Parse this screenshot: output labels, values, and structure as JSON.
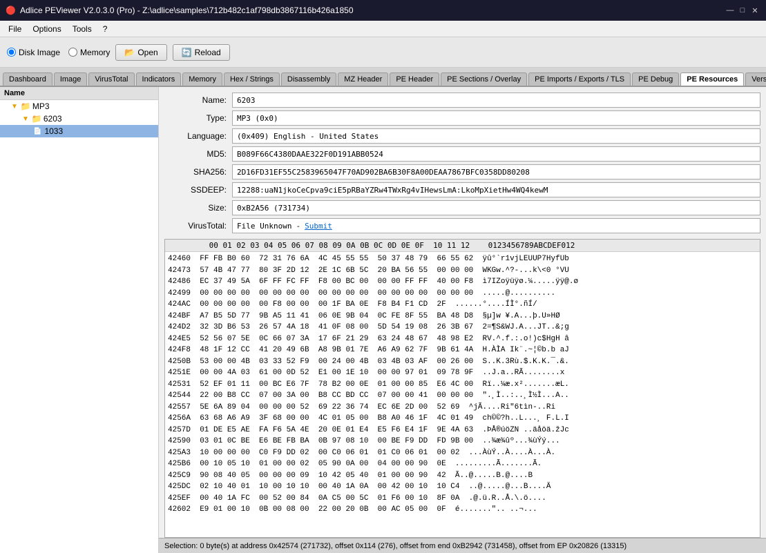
{
  "app": {
    "title": "Adlice PEViewer V2.0.3.0 (Pro) - Z:\\adlice\\samples\\712b482c1af798db3867116b426a1850",
    "icon": "🔴"
  },
  "titlebar_controls": {
    "minimize": "—",
    "maximize": "□",
    "close": "✕"
  },
  "menubar": {
    "items": [
      "File",
      "Options",
      "Tools",
      "?"
    ]
  },
  "toolbar": {
    "disk_image_label": "Disk Image",
    "memory_label": "Memory",
    "open_label": "Open",
    "reload_label": "Reload"
  },
  "tabs": [
    {
      "id": "dashboard",
      "label": "Dashboard"
    },
    {
      "id": "image",
      "label": "Image"
    },
    {
      "id": "virustotal",
      "label": "VirusTotal"
    },
    {
      "id": "indicators",
      "label": "Indicators"
    },
    {
      "id": "memory",
      "label": "Memory"
    },
    {
      "id": "hex",
      "label": "Hex / Strings"
    },
    {
      "id": "disassembly",
      "label": "Disassembly"
    },
    {
      "id": "mz-header",
      "label": "MZ Header"
    },
    {
      "id": "pe-header",
      "label": "PE Header"
    },
    {
      "id": "pe-sections",
      "label": "PE Sections / Overlay"
    },
    {
      "id": "pe-imports",
      "label": "PE Imports / Exports / TLS"
    },
    {
      "id": "pe-debug",
      "label": "PE Debug"
    },
    {
      "id": "pe-resources",
      "label": "PE Resources",
      "active": true
    },
    {
      "id": "version",
      "label": "Version..."
    }
  ],
  "tree": {
    "header": "Name",
    "items": [
      {
        "id": "mp3",
        "label": "MP3",
        "level": 1,
        "type": "folder",
        "expanded": true
      },
      {
        "id": "6203",
        "label": "6203",
        "level": 2,
        "type": "folder",
        "expanded": true
      },
      {
        "id": "1033",
        "label": "1033",
        "level": 3,
        "type": "file",
        "selected": true
      }
    ]
  },
  "fields": {
    "name": {
      "label": "Name:",
      "value": "6203"
    },
    "type": {
      "label": "Type:",
      "value": "MP3 (0x0)"
    },
    "language": {
      "label": "Language:",
      "value": "(0x409) English - United States"
    },
    "md5": {
      "label": "MD5:",
      "value": "B089F66C4380DAAE322F0D191ABB0524"
    },
    "sha256": {
      "label": "SHA256:",
      "value": "2D16FD31EF55C2583965047F70AD902BA6B30F8A00DEAA7867BFC0358DD80208"
    },
    "ssdeep": {
      "label": "SSDEEP:",
      "value": "12288:uaN1jkoCeCpva9ciE5pRBaYZRw4TWxRg4vIHewsLmA:LkoMpXietHw4WQ4kewM"
    },
    "size": {
      "label": "Size:",
      "value": "0xB2A56 (731734)"
    },
    "virustotal": {
      "label": "VirusTotal:",
      "value": "File Unknown",
      "submit": "Submit"
    }
  },
  "hex": {
    "header": "         00 01 02 03 04 05 06 07 08 09 0A 0B 0C 0D 0E 0F  10 11 12    0123456789ABCDEF012",
    "rows": [
      {
        "addr": "42460",
        "hex": "FF FB B0 60  72 31 76 6A  4C 45 55 55  50 37 48 79  66 55 62",
        "ascii": "ÿû°`r1vjLEUUP7HyfUb"
      },
      {
        "addr": "42473",
        "hex": "57 4B 47 77  80 3F 2D 12  2E 1C 6B 5C  20 BA 56 55  00 00 00",
        "ascii": "WKGw.^?-...k\\<0 °VU"
      },
      {
        "addr": "42486",
        "hex": "EC 37 49 5A  6F FF FC FF  F8 00 BC 00  00 00 FF FF  40 00 F8",
        "ascii": "ì7IZoÿüÿø.¼.....ÿÿ@.ø"
      },
      {
        "addr": "42499",
        "hex": "00 00 00 00  00 00 00 00  00 00 00 00  00 00 00 00  00 00 00",
        "ascii": ".....@.........."
      },
      {
        "addr": "424AC",
        "hex": "00 00 00 00  00 F8 00 00  00 1F BA 0E  F8 B4 F1 CD  2F",
        "ascii": "......°....ÍÌ°.ñÍ/"
      },
      {
        "addr": "424BF",
        "hex": "A7 B5 5D 77  9B A5 11 41  06 0E 9B 04  0C FE 8F 55  BA 48 D8",
        "ascii": "§µ]w ¥.A...þ.U»HØ"
      },
      {
        "addr": "424D2",
        "hex": "32 3D B6 53  26 57 4A 18  41 0F 08 00  5D 54 19 08  26 3B 67",
        "ascii": "2=¶S&WJ.A...JT..&;g"
      },
      {
        "addr": "424E5",
        "hex": "52 56 07 5E  0C 66 07 3A  17 6F 21 29  63 24 48 67  48 98 E2",
        "ascii": "RV.^.f.:.o!)c$HgH â"
      },
      {
        "addr": "424F8",
        "hex": "48 1F 12 CC  41 20 49 6B  A8 9B 01 7E  A6 A9 62 7F  9B 61 4A",
        "ascii": "H.ÀÌA Ik¨.~¦©b.b aJ"
      },
      {
        "addr": "4250B",
        "hex": "53 00 00 4B  03 33 52 F9  00 24 00 4B  03 4B 03 AF  00 26 00",
        "ascii": "S..K.3Rù.$.K.K.¯.&."
      },
      {
        "addr": "4251E",
        "hex": "00 00 4A 03  61 00 0D 52  E1 00 1E 10  00 00 97 01  09 78 9F",
        "ascii": "..J.a..RÃ........x"
      },
      {
        "addr": "42531",
        "hex": "52 EF 01 11  00 BC E6 7F  78 B2 00 0E  01 00 00 85  E6 4C 00",
        "ascii": "Rï..¼æ.x².......æL."
      },
      {
        "addr": "42544",
        "hex": "22 00 B8 CC  07 00 3A 00  B8 CC BD CC  07 00 00 41  00 00 00",
        "ascii": "\".¸Ì..:..¸Ì½Ì...A.."
      },
      {
        "addr": "42557",
        "hex": "5E 6A 89 04  00 00 00 52  69 22 36 74  EC 6E 2D 00  52 69",
        "ascii": "^jÃ....Ri\"6tìn-..Ri"
      },
      {
        "addr": "4256A",
        "hex": "63 68 A6 A9  3F 68 00 00  4C 01 05 00  B8 A0 46 1F  4C 01 49",
        "ascii": "ch©©?h..L...¸ F.L.I"
      },
      {
        "addr": "4257D",
        "hex": "01 DE E5 AE  FA F6 5A 4E  20 0E 01 E4  E5 F6 E4 1F  9E 4A 63",
        "ascii": ".ÞÅ®úöZN ..äåöä.žJc"
      },
      {
        "addr": "42590",
        "hex": "03 01 0C BE  E6 BE FB BA  0B 97 08 10  00 BE F9 DD  FD 9B 00",
        "ascii": "..¾æ¾ûº...¾ùÝý..."
      },
      {
        "addr": "425A3",
        "hex": "10 00 00 00  C0 F9 DD 02  00 C0 06 01  01 C0 06 01  00 02",
        "ascii": "...ÀùÝ..À....À...À."
      },
      {
        "addr": "425B6",
        "hex": "00 10 05 10  01 00 00 02  05 90 0A 00  04 00 00 90  0E",
        "ascii": ".........Ã.......Ã."
      },
      {
        "addr": "425C9",
        "hex": "90 08 40 05  00 00 00 09  10 42 05 40  01 00 00 90  42",
        "ascii": "Ã..@.....B.@....B"
      },
      {
        "addr": "425DC",
        "hex": "02 10 40 01  10 00 10 10  00 40 1A 0A  00 42 00 10  10 C4",
        "ascii": "..@.....@...B....Ä"
      },
      {
        "addr": "425EF",
        "hex": "00 40 1A FC  00 52 00 84  0A C5 00 5C  01 F6 00 10  8F 0A",
        "ascii": ".@.ü.R..Å.\\.ö...."
      },
      {
        "addr": "42602",
        "hex": "E9 01 00 10  0B 00 08 00  22 00 20 0B  00 AC 05 00  0F",
        "ascii": "é.......\".. ..¬..."
      }
    ]
  },
  "statusbar": {
    "text": "Selection: 0 byte(s) at address 0x42574 (271732), offset 0x114 (276), offset from end 0xB2942 (731458), offset from EP 0x20826 (13315)"
  }
}
